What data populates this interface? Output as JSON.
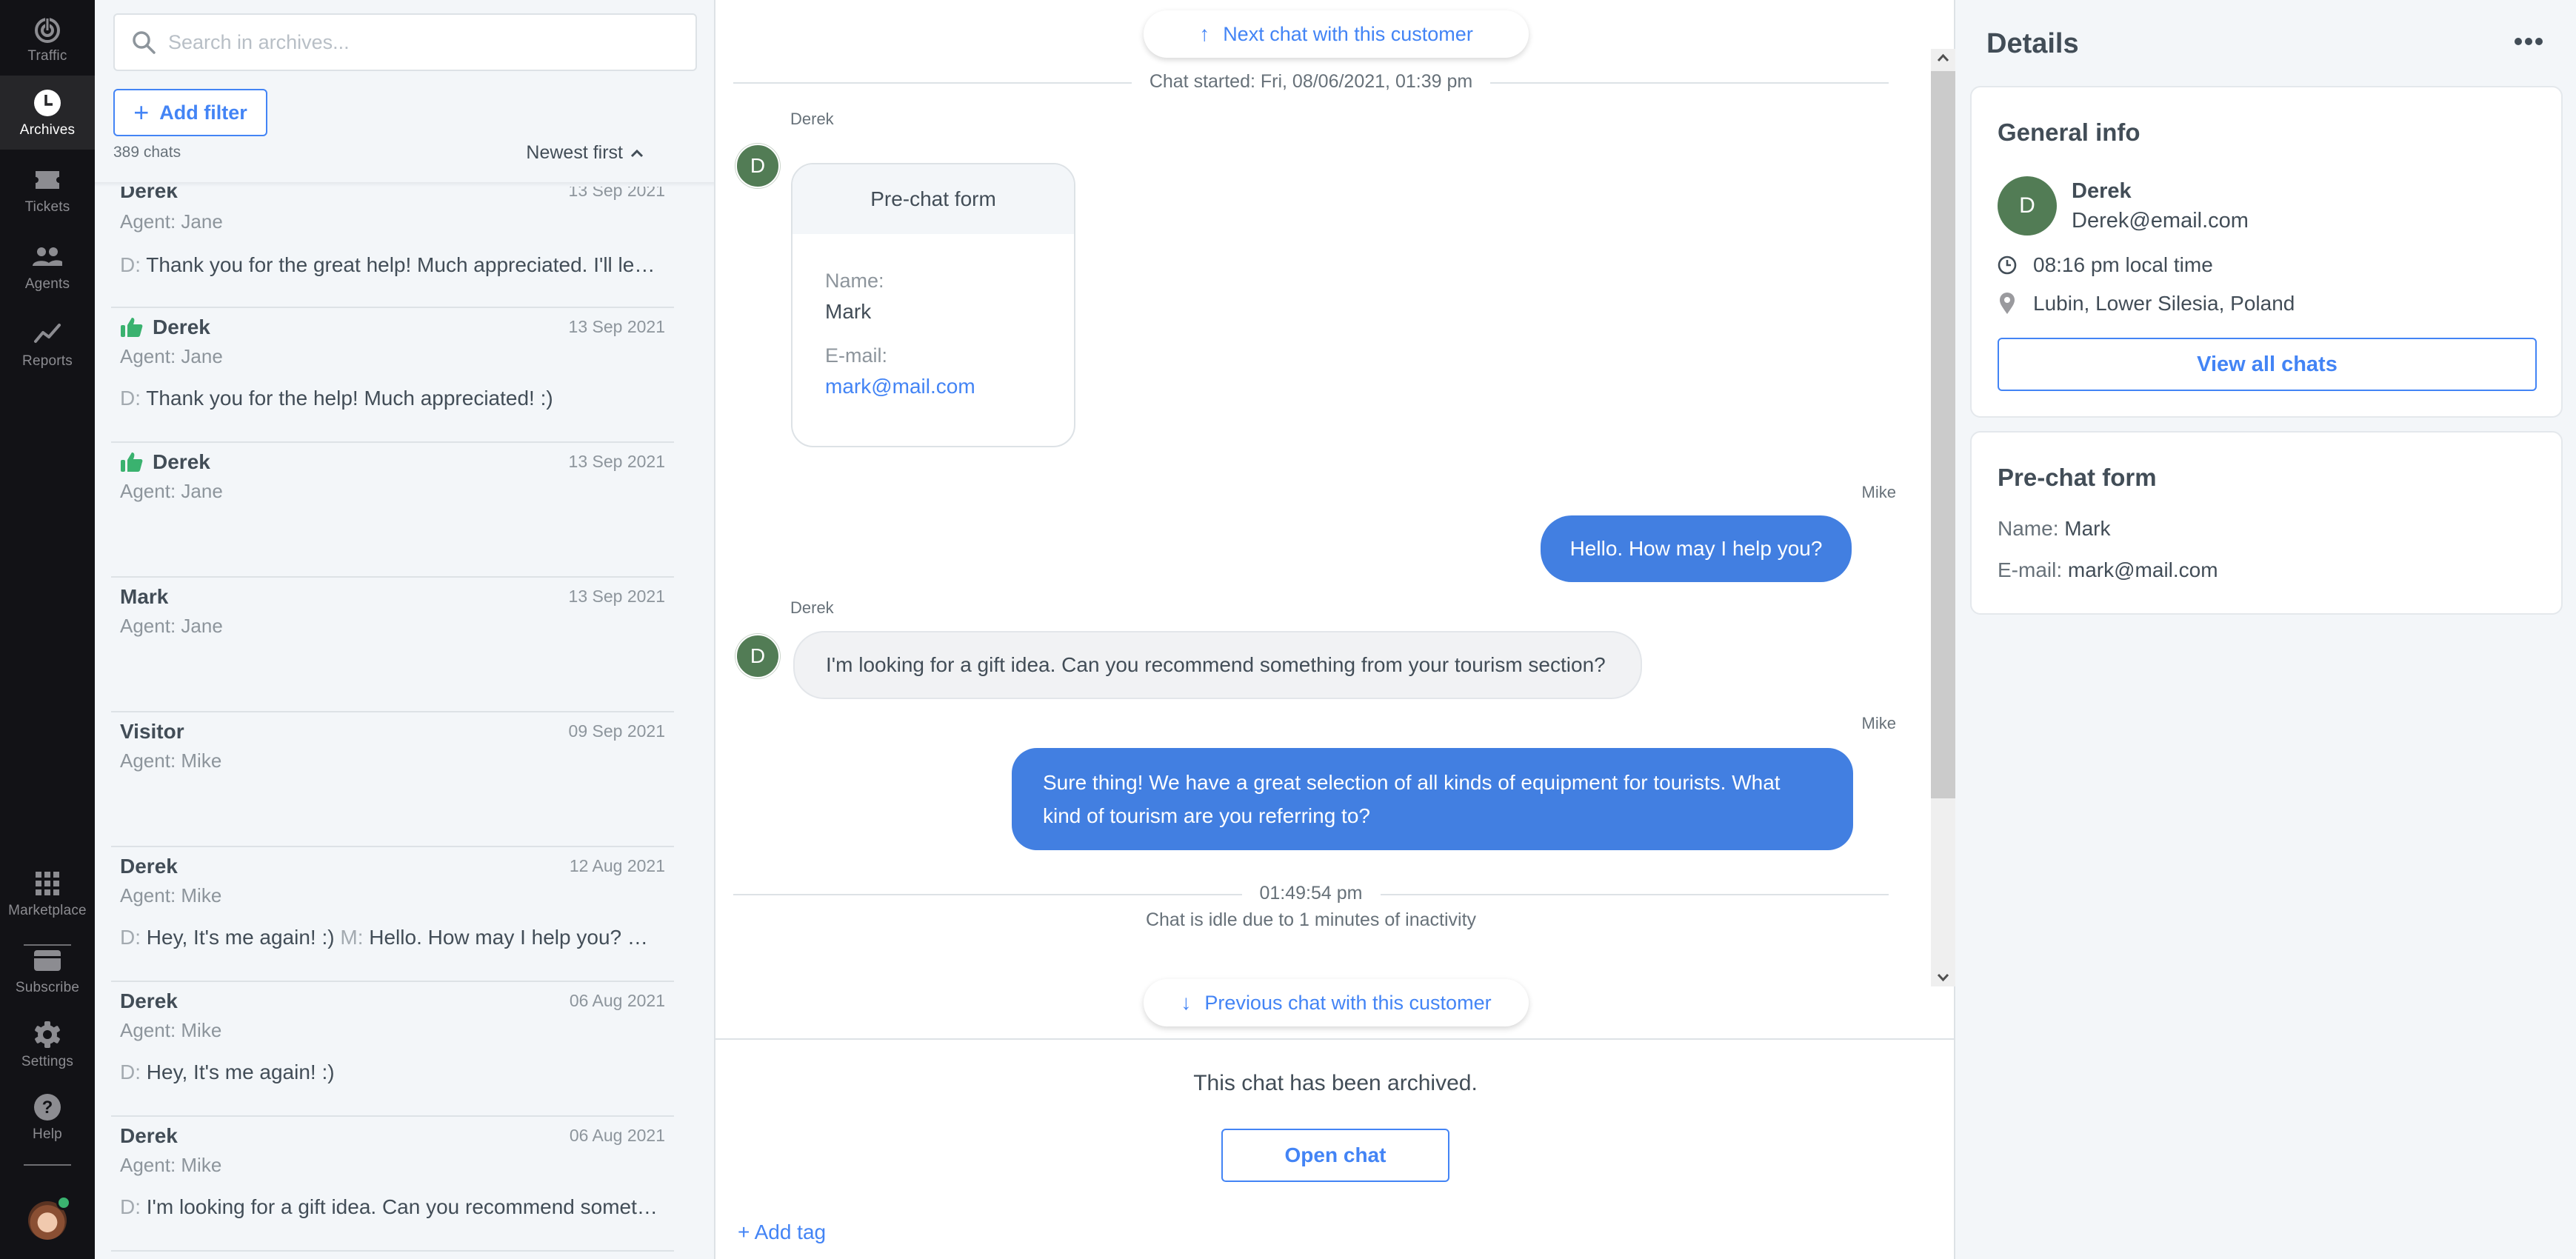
{
  "nav": {
    "items": [
      {
        "label": "Traffic",
        "icon": "traffic-icon",
        "active": false
      },
      {
        "label": "Archives",
        "icon": "clock-icon",
        "active": true
      },
      {
        "label": "Tickets",
        "icon": "ticket-icon",
        "active": false
      },
      {
        "label": "Agents",
        "icon": "agents-icon",
        "active": false
      },
      {
        "label": "Reports",
        "icon": "reports-icon",
        "active": false
      }
    ],
    "bottom_items": [
      {
        "label": "Marketplace",
        "icon": "grid-icon"
      },
      {
        "label": "Subscribe",
        "icon": "card-icon"
      },
      {
        "label": "Settings",
        "icon": "gear-icon"
      },
      {
        "label": "Help",
        "icon": "help-icon"
      }
    ],
    "user_status": "online"
  },
  "archives": {
    "search_placeholder": "Search in archives...",
    "add_filter_label": "Add filter",
    "count_label": "389 chats",
    "sort_label": "Newest first",
    "items": [
      {
        "name": "Derek",
        "date": "13 Sep 2021",
        "agent": "Agent: Jane",
        "rated": false,
        "preview": [
          {
            "prefix": "D:",
            "text": "Thank you for the great help! Much appreciated. I'll leave a good rating"
          }
        ]
      },
      {
        "name": "Derek",
        "date": "13 Sep 2021",
        "agent": "Agent: Jane",
        "rated": true,
        "preview": [
          {
            "prefix": "D:",
            "text": "Thank you for the help! Much appreciated! :)"
          }
        ]
      },
      {
        "name": "Derek",
        "date": "13 Sep 2021",
        "agent": "Agent: Jane",
        "rated": true,
        "preview": []
      },
      {
        "name": "Mark",
        "date": "13 Sep 2021",
        "agent": "Agent: Jane",
        "rated": false,
        "preview": []
      },
      {
        "name": "Visitor",
        "date": "09 Sep 2021",
        "agent": "Agent: Mike",
        "rated": false,
        "preview": []
      },
      {
        "name": "Derek",
        "date": "12 Aug 2021",
        "agent": "Agent: Mike",
        "rated": false,
        "preview": [
          {
            "prefix": "D:",
            "text": "Hey, It's me again! :)"
          },
          {
            "prefix": "M:",
            "text": "Hello. How may I help you?"
          },
          {
            "prefix": "M:",
            "text": "..."
          }
        ]
      },
      {
        "name": "Derek",
        "date": "06 Aug 2021",
        "agent": "Agent: Mike",
        "rated": false,
        "preview": [
          {
            "prefix": "D:",
            "text": "Hey, It's me again! :)"
          }
        ]
      },
      {
        "name": "Derek",
        "date": "06 Aug 2021",
        "agent": "Agent: Mike",
        "rated": false,
        "preview": [
          {
            "prefix": "D:",
            "text": "I'm looking for a gift idea. Can you recommend something from your tourism section?"
          }
        ]
      }
    ]
  },
  "chat": {
    "next_chat_label": "Next chat with this customer",
    "prev_chat_label": "Previous chat with this customer",
    "started_label": "Chat started: Fri, 08/06/2021, 01:39 pm",
    "customer_initial": "D",
    "prechat": {
      "author": "Derek",
      "title": "Pre-chat form",
      "name_label": "Name:",
      "name_value": "Mark",
      "email_label": "E-mail:",
      "email_value": "mark@mail.com"
    },
    "messages": [
      {
        "author": "Mike",
        "side": "agent",
        "text": "Hello. How may I help you?"
      },
      {
        "author": "Derek",
        "side": "customer",
        "text": "I'm looking for a gift idea. Can you recommend something from your tourism section?"
      },
      {
        "author": "Mike",
        "side": "agent",
        "text": "Sure thing! We have a great selection of all kinds of equipment for tourists. What kind of tourism are you referring to?"
      }
    ],
    "idle_time": "01:49:54 pm",
    "idle_text": "Chat is idle due to 1 minutes of inactivity",
    "archived_text": "This chat has been archived.",
    "open_chat_label": "Open chat",
    "add_tag_label": "+ Add tag"
  },
  "details": {
    "title": "Details",
    "general": {
      "title": "General info",
      "initial": "D",
      "name": "Derek",
      "email": "Derek@email.com",
      "local_time": "08:16 pm local time",
      "location": "Lubin, Lower Silesia, Poland",
      "view_all_label": "View all chats"
    },
    "prechat": {
      "title": "Pre-chat form",
      "name_label": "Name:",
      "name_value": "Mark",
      "email_label": "E-mail:",
      "email_value": "mark@mail.com"
    }
  },
  "colors": {
    "accent": "#4384f5",
    "agent_bubble": "#427fe1",
    "avatar_green": "#527c55",
    "rating_green": "#3ab26f",
    "nav_bg": "#121216"
  }
}
